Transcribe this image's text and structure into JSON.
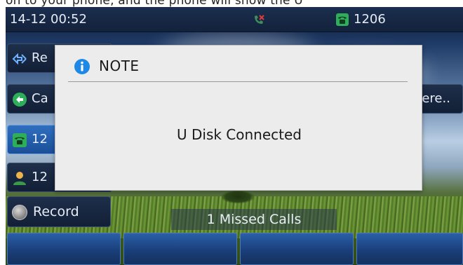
{
  "page_caption_fragment": "on to your phone, and the phone will show the U",
  "statusbar": {
    "datetime": "14-12 00:52",
    "icons": [
      "missed-call-icon",
      "phone-handset-icon"
    ],
    "account": "1206"
  },
  "line_keys": [
    {
      "icon": "sync-arrows-icon",
      "label": "Re"
    },
    {
      "icon": "call-back-icon",
      "label": "Ca"
    },
    {
      "icon": "phone-handset-icon",
      "label": "12",
      "active": true
    },
    {
      "icon": "contact-person-icon",
      "label": "12"
    }
  ],
  "right_key": {
    "label": "fere.."
  },
  "record_key": {
    "icon": "record-dot-icon",
    "label": "Record"
  },
  "missed_banner": "1 Missed Calls",
  "softkeys": [
    "",
    "",
    "",
    ""
  ],
  "modal": {
    "icon": "info-icon",
    "title": "NOTE",
    "message": "U Disk Connected"
  },
  "colors": {
    "modal_bg": "#ececec",
    "info_blue": "#1e88e5",
    "handset_green": "#2fae5a",
    "active_key": "#2f6fbf"
  }
}
